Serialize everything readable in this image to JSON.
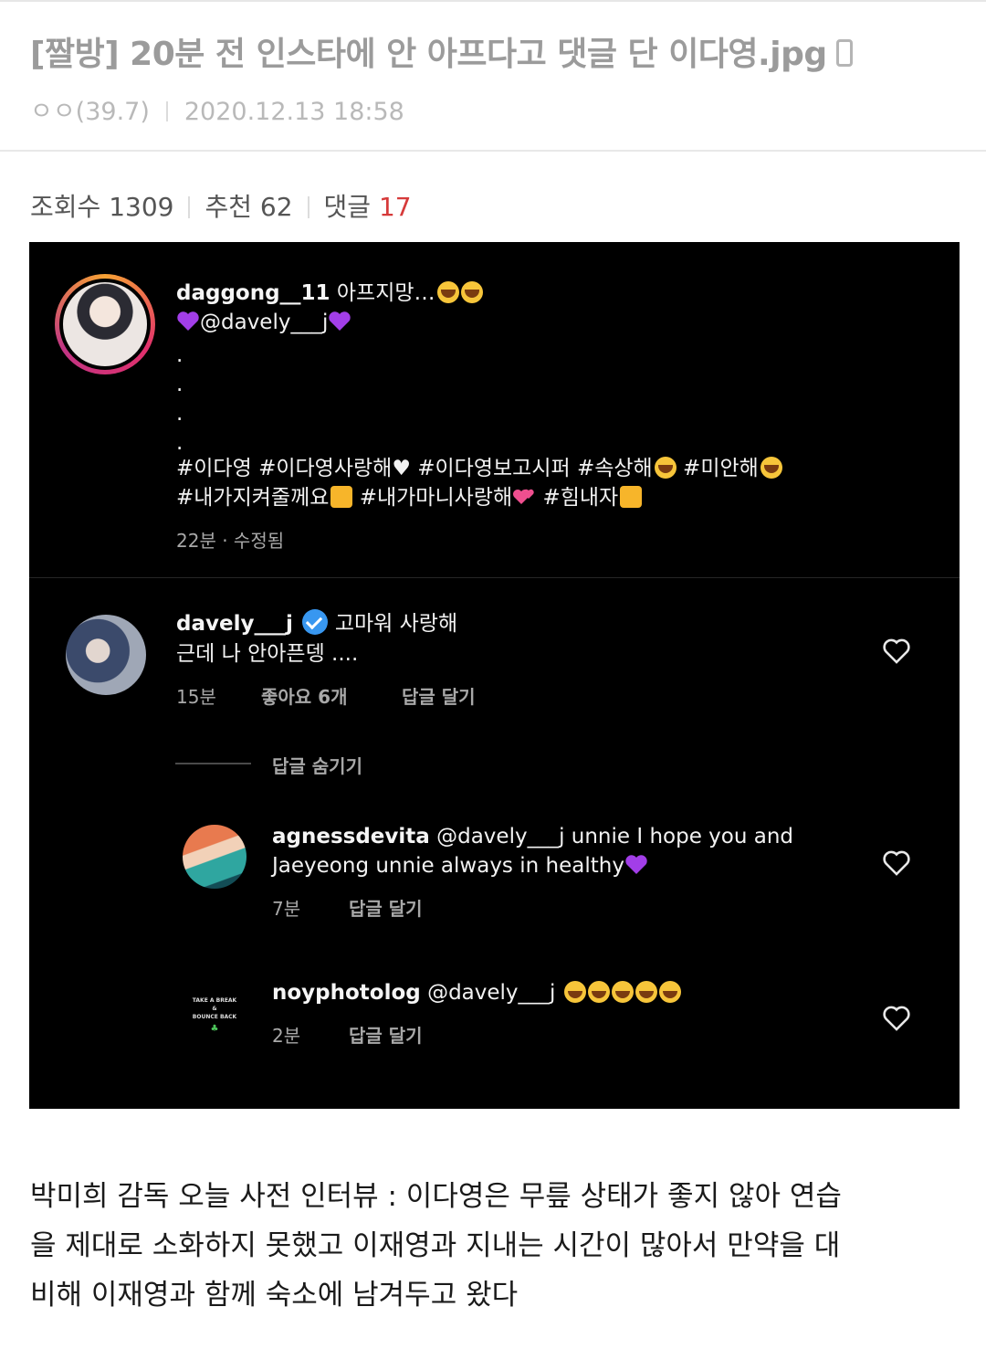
{
  "post": {
    "title": "[짤방] 20분 전 인스타에 안 아프다고 댓글 단 이다영.jpg",
    "author": "ㅇㅇ(39.7)",
    "datetime": "2020.12.13 18:58",
    "views_label": "조회수",
    "views": "1309",
    "recommend_label": "추천",
    "recommend": "62",
    "comments_label": "댓글",
    "comments": "17"
  },
  "screenshot": {
    "main_post": {
      "username": "daggong__11",
      "caption": "아프지망…",
      "mention": "@davely___j",
      "dots": [
        ".",
        ".",
        ".",
        "."
      ],
      "hashtags_line1": [
        "#이다영",
        "#이다영사랑해",
        "#이다영보고시퍼",
        "#속상해",
        "#미안해"
      ],
      "hashtags_line2": [
        "#내가지켜줄께요",
        "#내가마니사랑해",
        "#힘내자"
      ],
      "time": "22분 · 수정됨"
    },
    "comment1": {
      "username": "davely___j",
      "text_line1": "고마워 사랑해",
      "text_line2": "근데 나 안아픈뎅 ....",
      "time": "15분",
      "likes": "좋아요 6개",
      "reply": "답글 달기",
      "hide_replies": "답글 숨기기"
    },
    "reply1": {
      "username": "agnessdevita",
      "text_line1": "@davely___j unnie I hope you and",
      "text_line2": "Jaeyeong unnie always in healthy",
      "time": "7분",
      "reply": "답글 달기",
      "avatar_text": ""
    },
    "reply2": {
      "username": "noyphotolog",
      "text": "@davely___j",
      "time": "2분",
      "reply": "답글 달기",
      "avatar_text_1": "TAKE A BREAK",
      "avatar_text_2": "&",
      "avatar_text_3": "BOUNCE BACK"
    }
  },
  "caption_text": {
    "line1": "박미희 감독 오늘 사전 인터뷰 : 이다영은 무릎 상태가 좋지 않아 연습",
    "line2": "을 제대로 소화하지 못했고 이재영과 지내는 시간이 많아서 만약을 대",
    "line3": "비해 이재영과 함께 숙소에 남겨두고 왔다"
  },
  "colors": {
    "accent_red": "#d63a3a",
    "ig_background": "#000000",
    "verified_blue": "#3897f0",
    "purple_heart": "#a23ee8"
  }
}
